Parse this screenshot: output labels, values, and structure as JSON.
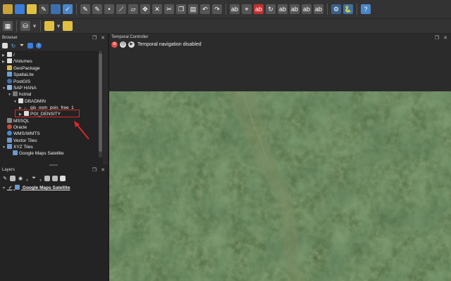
{
  "browser": {
    "title": "Browser",
    "items": [
      {
        "label": "/",
        "indent": 0,
        "arrow": "right",
        "icon": "folder"
      },
      {
        "label": "/Volumes",
        "indent": 0,
        "arrow": "right",
        "icon": "folder"
      },
      {
        "label": "GeoPackage",
        "indent": 0,
        "arrow": "",
        "icon": "geopackage"
      },
      {
        "label": "SpatiaLite",
        "indent": 0,
        "arrow": "",
        "icon": "spatialite"
      },
      {
        "label": "PostGIS",
        "indent": 0,
        "arrow": "",
        "icon": "postgis"
      },
      {
        "label": "SAP HANA",
        "indent": 0,
        "arrow": "down",
        "icon": "hana"
      },
      {
        "label": "hctrial",
        "indent": 1,
        "arrow": "down",
        "icon": "db"
      },
      {
        "label": "DBADMIN",
        "indent": 2,
        "arrow": "down",
        "icon": "schema"
      },
      {
        "label": "gis_osm_pois_free_1",
        "indent": 3,
        "arrow": "right",
        "icon": "points"
      },
      {
        "label": "POI_DENSITY",
        "indent": 3,
        "arrow": "right",
        "icon": "raster"
      },
      {
        "label": "MSSQL",
        "indent": 0,
        "arrow": "",
        "icon": "mssql"
      },
      {
        "label": "Oracle",
        "indent": 0,
        "arrow": "",
        "icon": "oracle"
      },
      {
        "label": "WMS/WMTS",
        "indent": 0,
        "arrow": "",
        "icon": "wms"
      },
      {
        "label": "Vector Tiles",
        "indent": 0,
        "arrow": "",
        "icon": "vectortiles"
      },
      {
        "label": "XYZ Tiles",
        "indent": 0,
        "arrow": "down",
        "icon": "xyz"
      },
      {
        "label": "Google Maps Satellite",
        "indent": 1,
        "arrow": "",
        "icon": "xyz"
      }
    ]
  },
  "layers": {
    "title": "Layers",
    "items": [
      {
        "label": "Google Maps Satellite",
        "checked": true
      }
    ]
  },
  "temporal": {
    "title": "Temporal Controller",
    "status": "Temporal navigation disabled"
  },
  "colors": {
    "highlight": "#e3262a",
    "accent": "#3b7dd8"
  }
}
